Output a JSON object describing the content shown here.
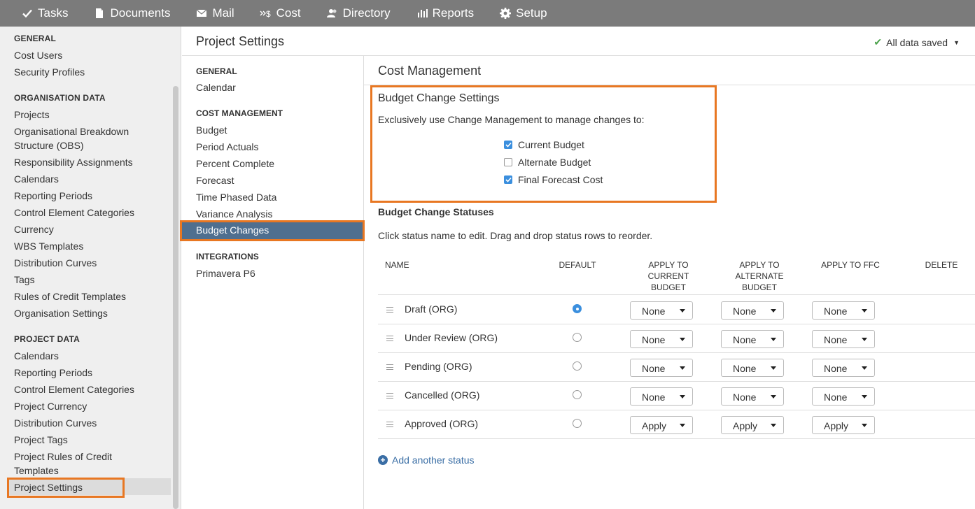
{
  "topnav": {
    "items": [
      {
        "label": "Tasks",
        "icon": "check-icon"
      },
      {
        "label": "Documents",
        "icon": "document-icon"
      },
      {
        "label": "Mail",
        "icon": "mail-icon"
      },
      {
        "label": "Cost",
        "icon": "cost-icon"
      },
      {
        "label": "Directory",
        "icon": "people-icon"
      },
      {
        "label": "Reports",
        "icon": "bar-chart-icon"
      },
      {
        "label": "Setup",
        "icon": "gear-icon"
      }
    ]
  },
  "sidebar": {
    "general": {
      "title": "GENERAL",
      "items": [
        "Cost Users",
        "Security Profiles"
      ]
    },
    "org": {
      "title": "ORGANISATION DATA",
      "items": [
        "Projects",
        "Organisational Breakdown Structure (OBS)",
        "Responsibility Assignments",
        "Calendars",
        "Reporting Periods",
        "Control Element Categories",
        "Currency",
        "WBS Templates",
        "Distribution Curves",
        "Tags",
        "Rules of Credit Templates",
        "Organisation Settings"
      ]
    },
    "project": {
      "title": "PROJECT DATA",
      "items": [
        "Calendars",
        "Reporting Periods",
        "Control Element Categories",
        "Project Currency",
        "Distribution Curves",
        "Project Tags",
        "Project Rules of Credit Templates",
        "Project Settings"
      ]
    }
  },
  "header": {
    "title": "Project Settings",
    "saved": "All data saved"
  },
  "midnav": {
    "general": {
      "title": "GENERAL",
      "items": [
        "Calendar"
      ]
    },
    "cost": {
      "title": "COST MANAGEMENT",
      "items": [
        "Budget",
        "Period Actuals",
        "Percent Complete",
        "Forecast",
        "Time Phased Data",
        "Variance Analysis",
        "Budget Changes"
      ]
    },
    "integrations": {
      "title": "INTEGRATIONS",
      "items": [
        "Primavera P6"
      ]
    }
  },
  "content": {
    "title": "Cost Management",
    "settings": {
      "title": "Budget Change Settings",
      "description": "Exclusively use Change Management to manage changes to:",
      "options": [
        {
          "label": "Current Budget",
          "checked": true
        },
        {
          "label": "Alternate Budget",
          "checked": false
        },
        {
          "label": "Final Forecast Cost",
          "checked": true
        }
      ]
    },
    "statuses": {
      "title": "Budget Change Statuses",
      "description": "Click status name to edit. Drag and drop status rows to reorder.",
      "columns": {
        "name": "NAME",
        "default": "DEFAULT",
        "current_1": "APPLY TO",
        "current_2": "CURRENT",
        "current_3": "BUDGET",
        "alt_1": "APPLY TO",
        "alt_2": "ALTERNATE",
        "alt_3": "BUDGET",
        "ffc": "APPLY TO FFC",
        "delete": "DELETE"
      },
      "rows": [
        {
          "name": "Draft (ORG)",
          "default": true,
          "current": "None",
          "alternate": "None",
          "ffc": "None"
        },
        {
          "name": "Under Review (ORG)",
          "default": false,
          "current": "None",
          "alternate": "None",
          "ffc": "None"
        },
        {
          "name": "Pending (ORG)",
          "default": false,
          "current": "None",
          "alternate": "None",
          "ffc": "None"
        },
        {
          "name": "Cancelled (ORG)",
          "default": false,
          "current": "None",
          "alternate": "None",
          "ffc": "None"
        },
        {
          "name": "Approved (ORG)",
          "default": false,
          "current": "Apply",
          "alternate": "Apply",
          "ffc": "Apply"
        }
      ],
      "add_label": "Add another status"
    }
  },
  "colors": {
    "topnav": "#7b7b7b",
    "accent": "#e87722",
    "selected": "#4f6f8f",
    "link": "#3a6ea5",
    "check": "#4aa14a"
  }
}
